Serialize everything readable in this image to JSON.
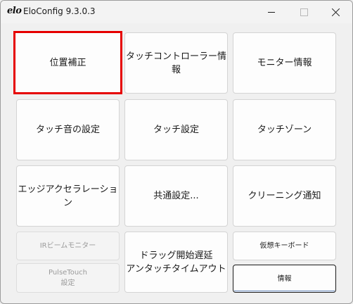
{
  "window": {
    "logo": "elo",
    "title": "EloConfig 9.3.0.3"
  },
  "tiles": {
    "position_correction": "位置補正",
    "touch_controller_info": "タッチコントローラー情報",
    "monitor_info": "モニター情報",
    "touch_sound_settings": "タッチ音の設定",
    "touch_settings": "タッチ設定",
    "touch_zone": "タッチゾーン",
    "edge_acceleration": "エッジアクセラレーション",
    "common_settings": "共通設定...",
    "cleaning_notification": "クリーニング通知",
    "ir_beam_monitor": "IRビームモニター",
    "pulsetouch_settings": "PulseTouch\n設定",
    "drag_delay_untouch_timeout": "ドラッグ開始遅延\nアンタッチタイムアウト",
    "virtual_keyboard": "仮想キーボード",
    "information": "情報"
  }
}
